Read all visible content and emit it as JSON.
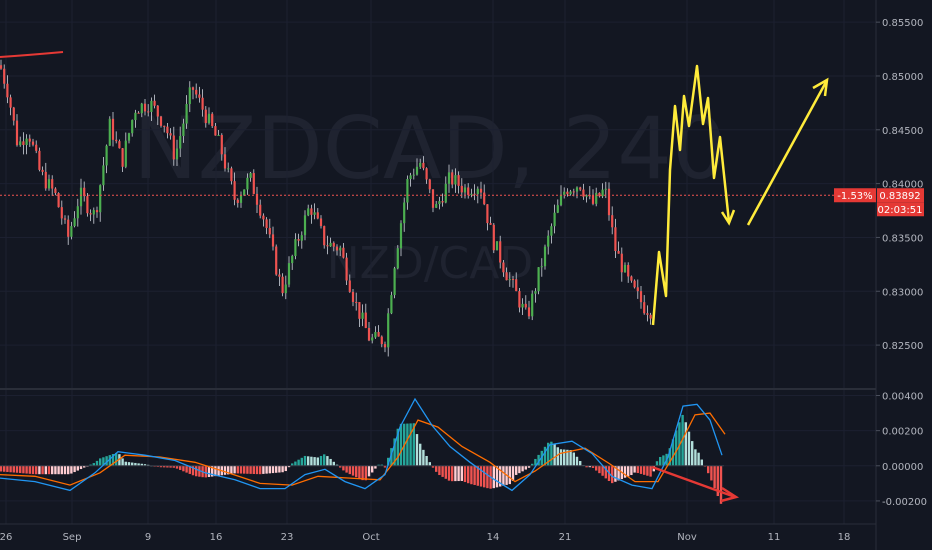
{
  "chart_data": [
    {
      "type": "candlestick",
      "symbol": "NZDCAD",
      "timeframe": "240",
      "watermark_title": "NZDCAD, 240",
      "watermark_subtitle": "NZD/CAD",
      "price_axis": {
        "ticks": [
          "0.85500",
          "0.85000",
          "0.84500",
          "0.84000",
          "0.83500",
          "0.83000",
          "0.82500"
        ],
        "range": [
          0.8225,
          0.8565
        ]
      },
      "time_axis": {
        "ticks": [
          "26",
          "Sep",
          "9",
          "16",
          "23",
          "Oct",
          "14",
          "21",
          "Nov",
          "11",
          "18"
        ]
      },
      "current_price": {
        "label": "0.83892",
        "value": 0.83892,
        "change": "-1.53%",
        "countdown": "02:03:51"
      },
      "price_path": [
        [
          0,
          0.851
        ],
        [
          8,
          0.8485
        ],
        [
          18,
          0.8435
        ],
        [
          28,
          0.845
        ],
        [
          40,
          0.841
        ],
        [
          55,
          0.839
        ],
        [
          68,
          0.835
        ],
        [
          80,
          0.839
        ],
        [
          95,
          0.837
        ],
        [
          110,
          0.8455
        ],
        [
          122,
          0.842
        ],
        [
          135,
          0.847
        ],
        [
          150,
          0.8475
        ],
        [
          165,
          0.8455
        ],
        [
          175,
          0.8425
        ],
        [
          192,
          0.849
        ],
        [
          205,
          0.8465
        ],
        [
          220,
          0.8435
        ],
        [
          235,
          0.8385
        ],
        [
          250,
          0.8405
        ],
        [
          265,
          0.8365
        ],
        [
          282,
          0.83
        ],
        [
          295,
          0.834
        ],
        [
          310,
          0.838
        ],
        [
          325,
          0.8345
        ],
        [
          340,
          0.834
        ],
        [
          355,
          0.829
        ],
        [
          370,
          0.8255
        ],
        [
          385,
          0.8255
        ],
        [
          395,
          0.833
        ],
        [
          408,
          0.8405
        ],
        [
          420,
          0.842
        ],
        [
          435,
          0.8375
        ],
        [
          450,
          0.8405
        ],
        [
          465,
          0.8395
        ],
        [
          480,
          0.84
        ],
        [
          492,
          0.835
        ],
        [
          505,
          0.832
        ],
        [
          515,
          0.83
        ],
        [
          527,
          0.8275
        ],
        [
          540,
          0.832
        ],
        [
          553,
          0.8365
        ],
        [
          565,
          0.8395
        ],
        [
          580,
          0.84
        ],
        [
          592,
          0.838
        ],
        [
          605,
          0.8395
        ],
        [
          615,
          0.834
        ],
        [
          630,
          0.8305
        ],
        [
          645,
          0.8285
        ],
        [
          652,
          0.8282
        ]
      ],
      "reference_line": 0.83892
    },
    {
      "type": "macd",
      "y_axis": {
        "ticks": [
          "0.00400",
          "0.00200",
          "0.00000",
          "-0.00200"
        ],
        "range": [
          -0.0032,
          0.0042
        ]
      },
      "macd_path": [
        [
          0,
          -0.0007
        ],
        [
          35,
          -0.0009
        ],
        [
          70,
          -0.0014
        ],
        [
          95,
          -0.0004
        ],
        [
          118,
          0.0008
        ],
        [
          145,
          0.0006
        ],
        [
          175,
          0.0003
        ],
        [
          205,
          -0.0004
        ],
        [
          235,
          -0.0008
        ],
        [
          260,
          -0.0013
        ],
        [
          285,
          -0.0013
        ],
        [
          305,
          -0.0005
        ],
        [
          325,
          -0.0002
        ],
        [
          345,
          -0.0009
        ],
        [
          365,
          -0.0013
        ],
        [
          385,
          -0.0005
        ],
        [
          400,
          0.0022
        ],
        [
          415,
          0.0038
        ],
        [
          432,
          0.0023
        ],
        [
          450,
          0.0011
        ],
        [
          470,
          0.0002
        ],
        [
          492,
          -0.0007
        ],
        [
          512,
          -0.0014
        ],
        [
          530,
          -0.0005
        ],
        [
          550,
          0.0012
        ],
        [
          572,
          0.0014
        ],
        [
          592,
          0.0007
        ],
        [
          612,
          -0.0006
        ],
        [
          632,
          -0.0011
        ],
        [
          652,
          -0.0013
        ],
        [
          668,
          0.0005
        ],
        [
          683,
          0.0034
        ],
        [
          697,
          0.0035
        ],
        [
          710,
          0.0026
        ],
        [
          722,
          0.0006
        ]
      ],
      "signal_path": [
        [
          0,
          -0.0005
        ],
        [
          35,
          -0.0006
        ],
        [
          70,
          -0.0011
        ],
        [
          100,
          -0.0004
        ],
        [
          125,
          0.0006
        ],
        [
          160,
          0.0005
        ],
        [
          195,
          0.0002
        ],
        [
          228,
          -0.0004
        ],
        [
          260,
          -0.001
        ],
        [
          292,
          -0.0011
        ],
        [
          318,
          -0.0006
        ],
        [
          350,
          -0.0007
        ],
        [
          380,
          -0.0008
        ],
        [
          398,
          0.0005
        ],
        [
          418,
          0.0026
        ],
        [
          438,
          0.0022
        ],
        [
          462,
          0.0011
        ],
        [
          490,
          0.0002
        ],
        [
          515,
          -0.0009
        ],
        [
          535,
          -0.0003
        ],
        [
          560,
          0.0007
        ],
        [
          585,
          0.001
        ],
        [
          610,
          0.0001
        ],
        [
          635,
          -0.0009
        ],
        [
          658,
          -0.0009
        ],
        [
          678,
          0.001
        ],
        [
          695,
          0.0029
        ],
        [
          710,
          0.003
        ],
        [
          725,
          0.0018
        ]
      ],
      "zero_line": 0.0
    }
  ],
  "colors": {
    "background": "#131722",
    "up": "#4caf50",
    "down": "#ef5350",
    "wick": "#cfd3dc",
    "macd": "#2196f3",
    "signal": "#ff6d00",
    "hist_up_strong": "#26a69a",
    "hist_up_weak": "#b2dfdb",
    "hist_down_strong": "#ef5350",
    "hist_down_weak": "#ffcdd2",
    "price_line": "#ef5350",
    "badge": "#e53935",
    "annotation_yellow": "#ffeb3b",
    "annotation_red": "#e53935"
  }
}
